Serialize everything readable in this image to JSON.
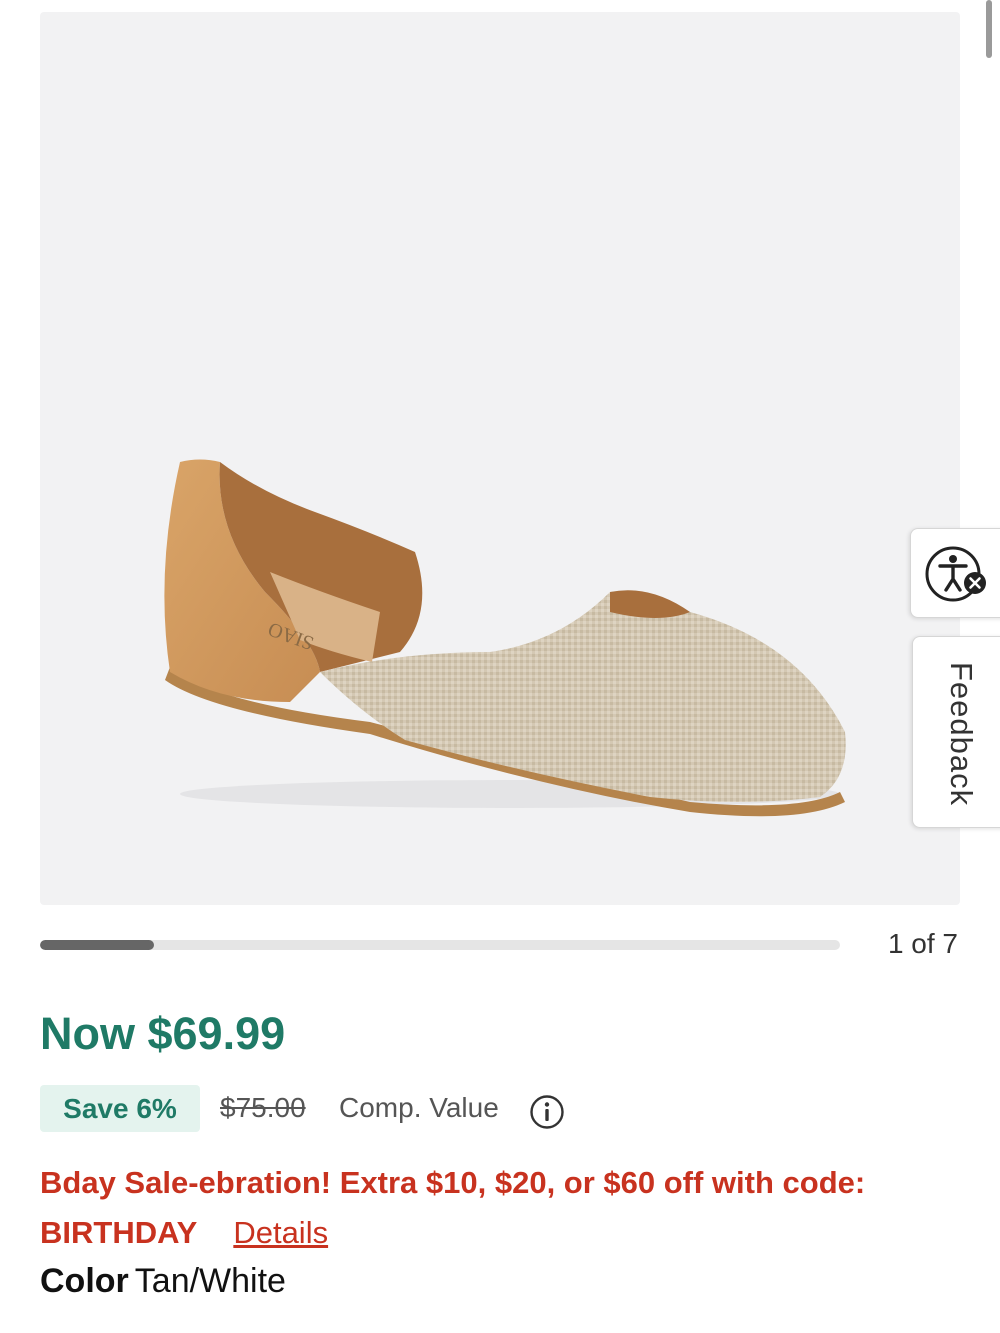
{
  "gallery": {
    "image_alt": "Tan/White d'Orsay flat shoe",
    "insole_brand_text": "SIAO",
    "slide_counter": "1 of 7",
    "progress_fraction": 0.143
  },
  "price": {
    "now_label": "Now $69.99",
    "save_badge": "Save 6%",
    "comp_value_price": "$75.00",
    "comp_value_label": "Comp. Value"
  },
  "promo": {
    "text": "Bday Sale-ebration! Extra $10, $20, or $60 off with code: BIRTHDAY",
    "details_link": "Details"
  },
  "color": {
    "label": "Color",
    "value": "Tan/White"
  },
  "side_tabs": {
    "feedback_label": "Feedback"
  },
  "colors": {
    "price_green": "#1f7a66",
    "save_badge_bg": "#e4f3ee",
    "promo_red": "#c8321f"
  },
  "icons": {
    "info": "info-circle-icon",
    "accessibility": "accessibility-icon"
  }
}
